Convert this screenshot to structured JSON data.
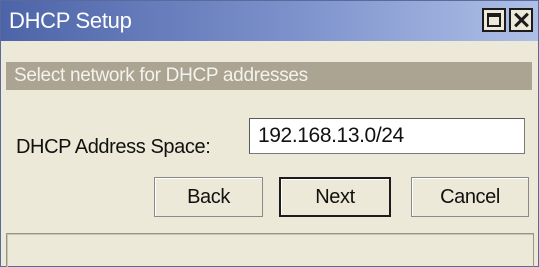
{
  "window": {
    "title": "DHCP Setup",
    "controls": {
      "maximize_icon": "maximize-icon",
      "close_icon": "close-icon"
    }
  },
  "banner": {
    "text": "Select network for DHCP addresses"
  },
  "form": {
    "address_space_label": "DHCP Address Space:",
    "address_space_value": "192.168.13.0/24"
  },
  "buttons": {
    "back": "Back",
    "next": "Next",
    "cancel": "Cancel"
  },
  "colors": {
    "titlebar_start": "#4d64a8",
    "titlebar_end": "#aebfe6",
    "banner": "#aba492",
    "window_bg": "#ece9d8"
  }
}
